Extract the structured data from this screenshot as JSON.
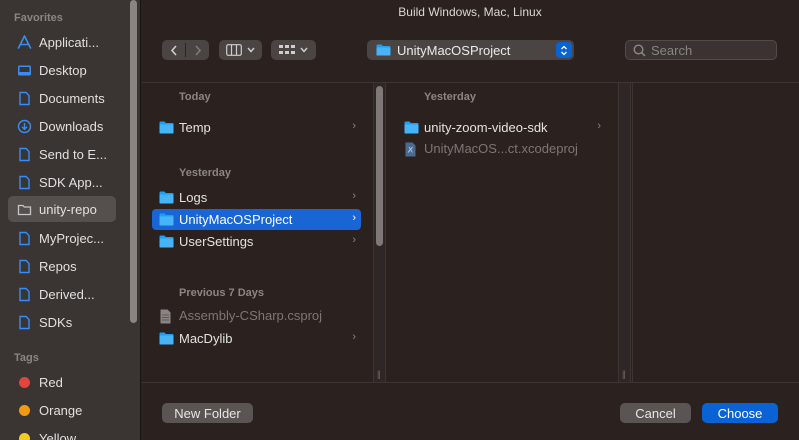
{
  "title": "Build Windows, Mac, Linux",
  "sidebar": {
    "favorites_header": "Favorites",
    "items": [
      {
        "label": "Applicati...",
        "icon": "applications-icon"
      },
      {
        "label": "Desktop",
        "icon": "desktop-icon"
      },
      {
        "label": "Documents",
        "icon": "document-icon"
      },
      {
        "label": "Downloads",
        "icon": "downloads-icon"
      },
      {
        "label": "Send to E...",
        "icon": "document-icon"
      },
      {
        "label": "SDK App...",
        "icon": "document-icon"
      },
      {
        "label": "unity-repo",
        "icon": "folder-icon"
      },
      {
        "label": "MyProjec...",
        "icon": "document-icon"
      },
      {
        "label": "Repos",
        "icon": "document-icon"
      },
      {
        "label": "Derived...",
        "icon": "document-icon"
      },
      {
        "label": "SDKs",
        "icon": "document-icon"
      }
    ],
    "tags_header": "Tags",
    "tags": [
      {
        "label": "Red",
        "color": "#e2453b"
      },
      {
        "label": "Orange",
        "color": "#f39b0c"
      },
      {
        "label": "Yellow",
        "color": "#f5cc1c"
      }
    ]
  },
  "toolbar": {
    "location": "UnityMacOSProject",
    "search_placeholder": "Search"
  },
  "column1": {
    "today_header": "Today",
    "yesterday_header": "Yesterday",
    "prev7_header": "Previous 7 Days",
    "rows": [
      {
        "label": "Temp"
      },
      {
        "label": "Logs"
      },
      {
        "label": "UnityMacOSProject"
      },
      {
        "label": "UserSettings"
      },
      {
        "label": "Assembly-CSharp.csproj"
      },
      {
        "label": "MacDylib"
      }
    ]
  },
  "column2": {
    "yesterday_header": "Yesterday",
    "rows": [
      {
        "label": "unity-zoom-video-sdk"
      },
      {
        "label": "UnityMacOS...ct.xcodeproj"
      }
    ]
  },
  "footer": {
    "new_folder": "New Folder",
    "cancel": "Cancel",
    "choose": "Choose"
  },
  "colors": {
    "accent": "#0a63d4",
    "selection": "#1a65d6",
    "folder": "#1e9ff2"
  }
}
